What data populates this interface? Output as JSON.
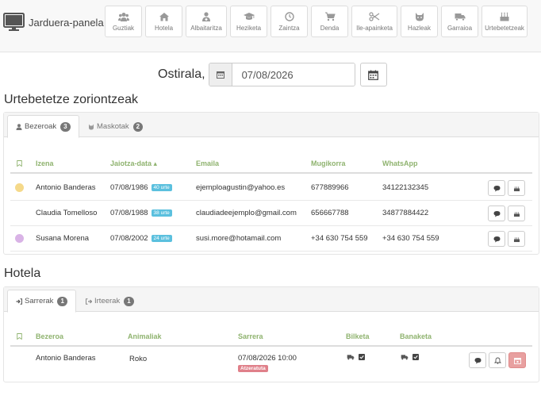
{
  "app": {
    "title": "Jarduera-panela"
  },
  "nav": [
    {
      "label": "Guztiak",
      "icon": "users-icon"
    },
    {
      "label": "Hotela",
      "icon": "home-icon"
    },
    {
      "label": "Albaitaritza",
      "icon": "user-md-icon"
    },
    {
      "label": "Heziketa",
      "icon": "graduation-cap-icon"
    },
    {
      "label": "Zaintza",
      "icon": "clock-icon"
    },
    {
      "label": "Denda",
      "icon": "shopping-cart-icon"
    },
    {
      "label": "Ile-apainketa",
      "icon": "scissors-icon"
    },
    {
      "label": "Hazleak",
      "icon": "cat-icon"
    },
    {
      "label": "Garraioa",
      "icon": "truck-icon"
    },
    {
      "label": "Urtebetetzeak",
      "icon": "birthday-cake-icon"
    }
  ],
  "date": {
    "label": "Ostirala,",
    "value": "07/08/2026"
  },
  "birthdays": {
    "title": "Urtebetetze zoriontzeak",
    "tabs": [
      {
        "label": "Bezeroak",
        "count": "3"
      },
      {
        "label": "Maskotak",
        "count": "2"
      }
    ],
    "columns": [
      "Izena",
      "Jaiotza-data",
      "Emaila",
      "Mugikorra",
      "WhatsApp"
    ],
    "rows": [
      {
        "name": "Antonio Banderas",
        "birth": "07/08/1986",
        "age": "40 urte",
        "email": "ejemploagustin@yahoo.es",
        "mobile": "677889966",
        "whatsapp": "34122132345",
        "dot": "#f5d98a"
      },
      {
        "name": "Claudia Tomelloso",
        "birth": "07/08/1988",
        "age": "38 urte",
        "email": "claudiadeejemplo@gmail.com",
        "mobile": "656667788",
        "whatsapp": "34877884422",
        "dot": ""
      },
      {
        "name": "Susana Morena",
        "birth": "07/08/2002",
        "age": "24 urte",
        "email": "susi.more@hotamail.com",
        "mobile": "+34 630 754 559",
        "whatsapp": "+34 630 754 559",
        "dot": "#d9b3e6"
      }
    ]
  },
  "hotel": {
    "title": "Hotela",
    "tabs": [
      {
        "label": "Sarrerak",
        "count": "1"
      },
      {
        "label": "Irteerak",
        "count": "1"
      }
    ],
    "columns": [
      "Bezeroa",
      "Animaliak",
      "Sarrera",
      "Bilketa",
      "Banaketa"
    ],
    "rows": [
      {
        "client": "Antonio Banderas",
        "animal": "Roko",
        "entry": "07/08/2026 10:00",
        "status": "Atzeratuta"
      }
    ]
  }
}
